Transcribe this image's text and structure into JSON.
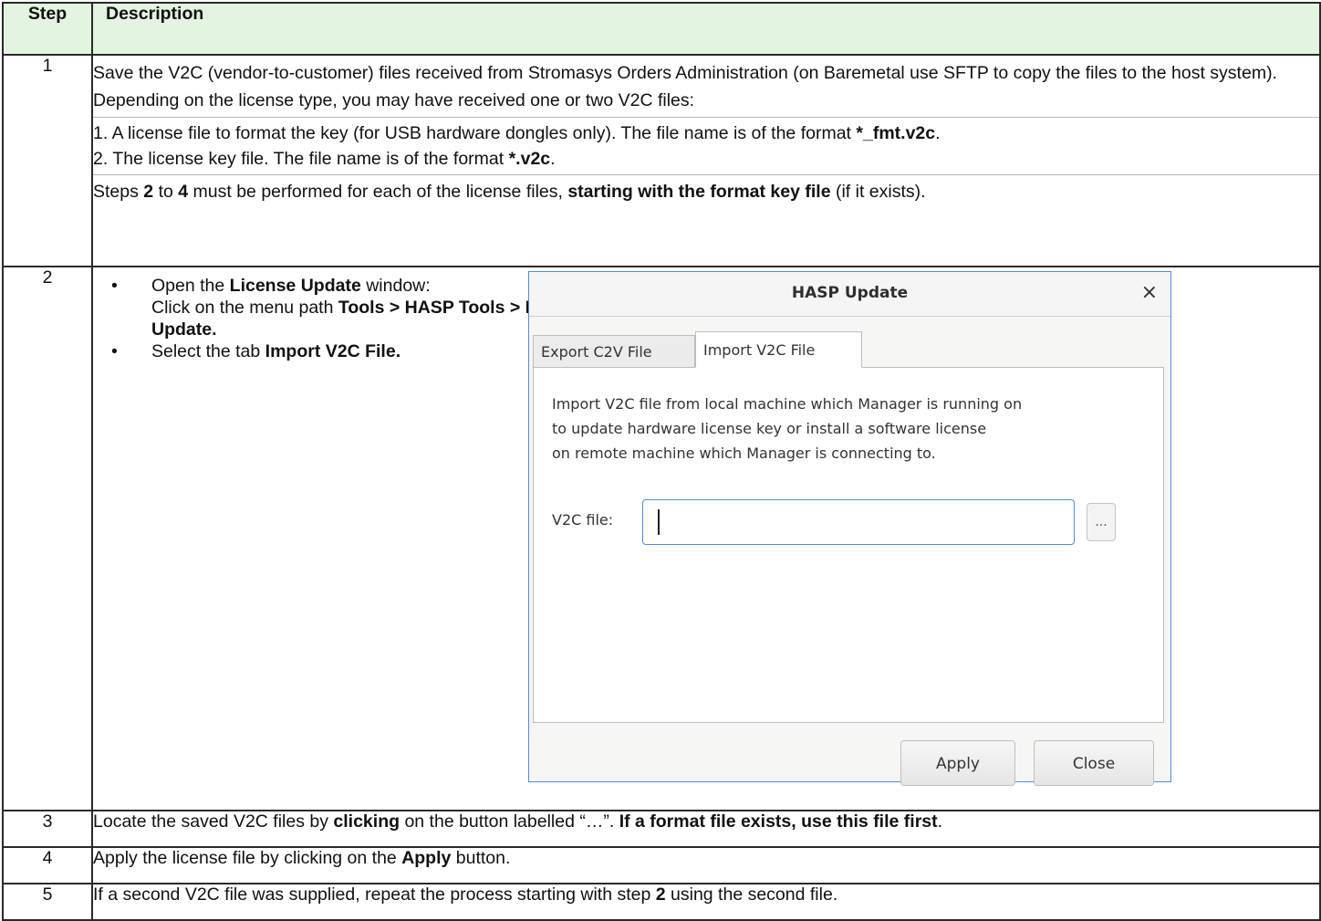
{
  "header": {
    "step": "Step",
    "description": "Description"
  },
  "steps": [
    {
      "number": "1",
      "line1": "Save the V2C (vendor-to-customer) files received from Stromasys Orders Administration (on Baremetal use SFTP to copy the files to the host system). Depending on the license type, you may have received one or two V2C files:",
      "item1_text": "1. A license file to format the key (for USB hardware dongles only). The file name is of the format ",
      "item1_bold": "*_fmt.v2c",
      "item1_end": ".",
      "item2_text": "2. The license key file. The file name is of the format ",
      "item2_bold": "*.v2c",
      "item2_end": ".",
      "note_a": "Steps ",
      "note_b": "2",
      "note_c": " to ",
      "note_d": "4",
      "note_e": " must be performed for each of the license files, ",
      "note_f": "starting with the format key file",
      "note_g": " (if it exists)."
    },
    {
      "number": "2",
      "bullet": "•",
      "b1_a": "Open the ",
      "b1_b": "License Update",
      "b1_c": " window:",
      "b1_d": "Click on the menu path ",
      "b1_e": "Tools > HASP Tools > HASP Update.",
      "b2_a": "Select the tab ",
      "b2_b": "Import V2C File."
    },
    {
      "number": "3",
      "a": "Locate the saved V2C files by ",
      "b": "clicking",
      "c": " on the button labelled “…”. ",
      "d": "If a format file exists, use this file first",
      "e": "."
    },
    {
      "number": "4",
      "a": "Apply the license file by clicking on the ",
      "b": "Apply",
      "c": " button."
    },
    {
      "number": "5",
      "a": "If a second V2C file was supplied, repeat the process starting with step ",
      "b": "2",
      "c": " using the second file."
    }
  ],
  "dialog": {
    "title": "HASP Update",
    "close_symbol": "×",
    "tabs": [
      "Export C2V File",
      "Import V2C File"
    ],
    "active_tab": "Import V2C File",
    "description": "Import V2C file from local machine which Manager is running on to update hardware license key or install a software license on remote machine which Manager is connecting to.",
    "desc_line1": "Import V2C file from local machine which Manager is running on",
    "desc_line2": "to update hardware license key or install a software license",
    "desc_line3": "on remote machine which Manager is connecting to.",
    "v2c_label": "V2C file:",
    "v2c_value": "",
    "browse_label": "...",
    "apply_label": "Apply",
    "close_label": "Close"
  }
}
